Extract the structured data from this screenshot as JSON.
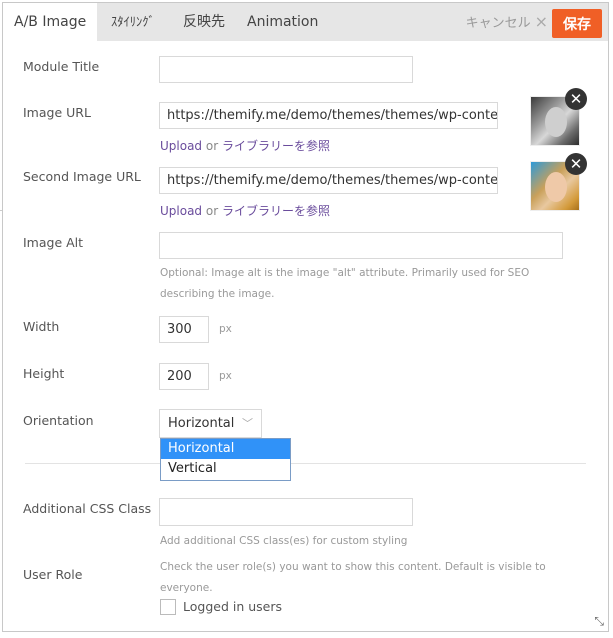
{
  "header": {
    "tabs": [
      {
        "label": "A/B Image",
        "active": true
      },
      {
        "label": "ｽﾀｲﾘﾝｸﾞ",
        "active": false
      },
      {
        "label": "反映先",
        "active": false
      },
      {
        "label": "Animation",
        "active": false
      }
    ],
    "cancel_label": "キャンセル",
    "cancel_icon": "×",
    "save_label": "保存",
    "save_color": "#f05f26"
  },
  "form": {
    "module_title": {
      "label": "Module Title",
      "value": ""
    },
    "image_url": {
      "label": "Image URL",
      "value": "https://themify.me/demo/themes/themes/wp-content",
      "upload_label": "Upload",
      "or_label": "or",
      "browse_label": "ライブラリーを参照",
      "thumbnail": "grayscale-portrait"
    },
    "second_image_url": {
      "label": "Second Image URL",
      "value": "https://themify.me/demo/themes/themes/wp-content",
      "upload_label": "Upload",
      "or_label": "or",
      "browse_label": "ライブラリーを参照",
      "thumbnail": "color-portrait"
    },
    "image_alt": {
      "label": "Image Alt",
      "value": "",
      "help": "Optional: Image alt is the image \"alt\" attribute. Primarily used for SEO describing the image."
    },
    "width": {
      "label": "Width",
      "value": "300",
      "unit": "px"
    },
    "height": {
      "label": "Height",
      "value": "200",
      "unit": "px"
    },
    "orientation": {
      "label": "Orientation",
      "value": "Horizontal",
      "options": [
        "Horizontal",
        "Vertical"
      ],
      "highlighted": "Horizontal"
    },
    "css_class": {
      "label": "Additional CSS Class",
      "value": "",
      "help": "Add additional CSS class(es) for custom styling"
    },
    "user_role": {
      "label": "User Role",
      "help": "Check the user role(s) you want to show this content. Default is visible to everyone.",
      "checkbox_label": "Logged in users",
      "checked": false
    }
  },
  "icons": {
    "remove": "✕",
    "chevron": "﹀",
    "resize": "⤡"
  }
}
